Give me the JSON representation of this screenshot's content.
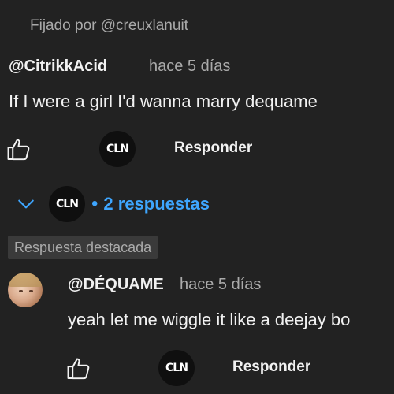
{
  "pinned_label": "Fijado por @creuxlanuit",
  "comment": {
    "author": "@CitrikkAcid",
    "time": "hace 5 días",
    "text": "If I were a girl I'd wanna marry dequame",
    "reply_label": "Responder",
    "creator_badge_text": "CLN"
  },
  "replies_toggle": {
    "badge_text": "CLN",
    "separator": "•",
    "label": "2 respuestas"
  },
  "highlighted_label": "Respuesta destacada",
  "reply": {
    "author": "@DÉQUAME",
    "time": "hace 5 días",
    "text": "yeah let me wiggle it like a deejay bo",
    "reply_label": "Responder",
    "creator_badge_text": "CLN"
  },
  "colors": {
    "background": "#222222",
    "text_primary": "#f1f1f1",
    "text_secondary": "#aaaaaa",
    "link_blue": "#3ea6ff",
    "badge_bg": "#3a3a3a"
  },
  "icons": {
    "like": "thumbs-up-icon",
    "chevron": "chevron-down-icon"
  }
}
